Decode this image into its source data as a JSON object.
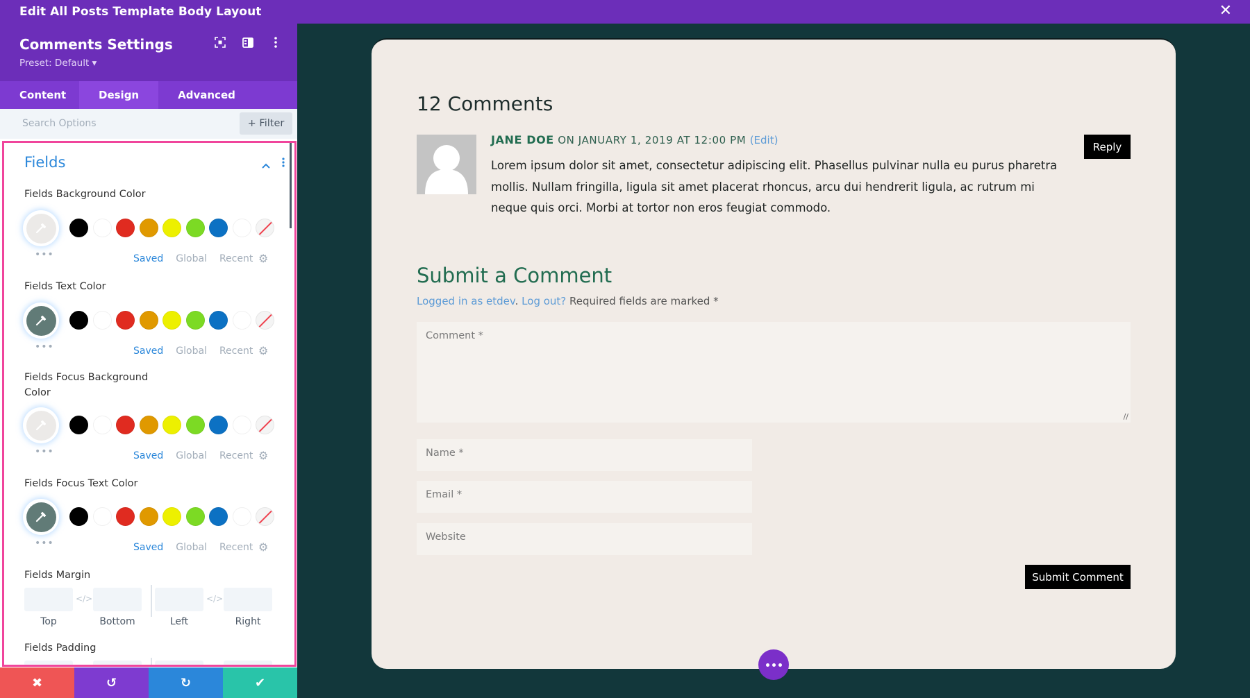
{
  "window": {
    "title": "Edit All Posts Template Body Layout",
    "close_icon": "close-icon"
  },
  "sidebar": {
    "title": "Comments Settings",
    "preset": "Preset: Default ▾",
    "header_icons": [
      "focus-mode-icon",
      "split-view-icon",
      "more-vertical-icon"
    ],
    "tabs": [
      {
        "label": "Content",
        "active": false
      },
      {
        "label": "Design",
        "active": true
      },
      {
        "label": "Advanced",
        "active": false
      }
    ],
    "search_placeholder": "Search Options",
    "filter_label": "+ Filter",
    "section": {
      "title": "Fields",
      "options": [
        {
          "label": "Fields Background Color",
          "eyedropper_color": "#eceae8"
        },
        {
          "label": "Fields Text Color",
          "eyedropper_color": "#617b77"
        },
        {
          "label": "Fields Focus Background Color",
          "eyedropper_color": "#eceae8"
        },
        {
          "label": "Fields Focus Text Color",
          "eyedropper_color": "#617b77"
        }
      ],
      "swatches": [
        "#000000",
        "#ffffff",
        "#e02b20",
        "#e09900",
        "#edf000",
        "#7cda24",
        "#0c71c3",
        "#ffffff",
        "none"
      ],
      "picker_tabs": [
        "Saved",
        "Global",
        "Recent"
      ],
      "active_picker_tab": "Saved",
      "margin": {
        "label": "Fields Margin",
        "sides": [
          "Top",
          "Bottom",
          "Left",
          "Right"
        ]
      },
      "padding": {
        "label": "Fields Padding"
      }
    },
    "bottom_actions": [
      {
        "name": "discard",
        "icon": "✖",
        "color": "#ef5555"
      },
      {
        "name": "undo",
        "icon": "↺",
        "color": "#7e3bd0"
      },
      {
        "name": "redo",
        "icon": "↻",
        "color": "#2b87da"
      },
      {
        "name": "save",
        "icon": "✔",
        "color": "#29c4a9"
      }
    ]
  },
  "preview": {
    "comments_title": "12 Comments",
    "comment": {
      "author": "JANE DOE",
      "date": " ON JANUARY 1, 2019 AT 12:00 PM ",
      "edit_link": "(Edit)",
      "text": "Lorem ipsum dolor sit amet, consectetur adipiscing elit. Phasellus pulvinar nulla eu purus pharetra mollis. Nullam fringilla, ligula sit amet placerat rhoncus, arcu dui hendrerit ligula, ac rutrum mi neque quis orci. Morbi at tortor non eros feugiat commodo.",
      "reply_label": "Reply"
    },
    "form": {
      "title": "Submit a Comment",
      "logged_in_link": "Logged in as etdev",
      "logout_link": "Log out?",
      "required_note": " Required fields are marked *",
      "comment_placeholder": "Comment *",
      "name_placeholder": "Name *",
      "email_placeholder": "Email *",
      "website_placeholder": "Website",
      "submit_label": "Submit Comment"
    }
  },
  "colors": {
    "brand_purple": "#6c2eb9",
    "accent_blue": "#2b87da",
    "highlight_pink": "#f0459c",
    "canvas_bg": "#12373b",
    "card_bg": "#f1ebe6",
    "heading_green": "#216c50"
  }
}
